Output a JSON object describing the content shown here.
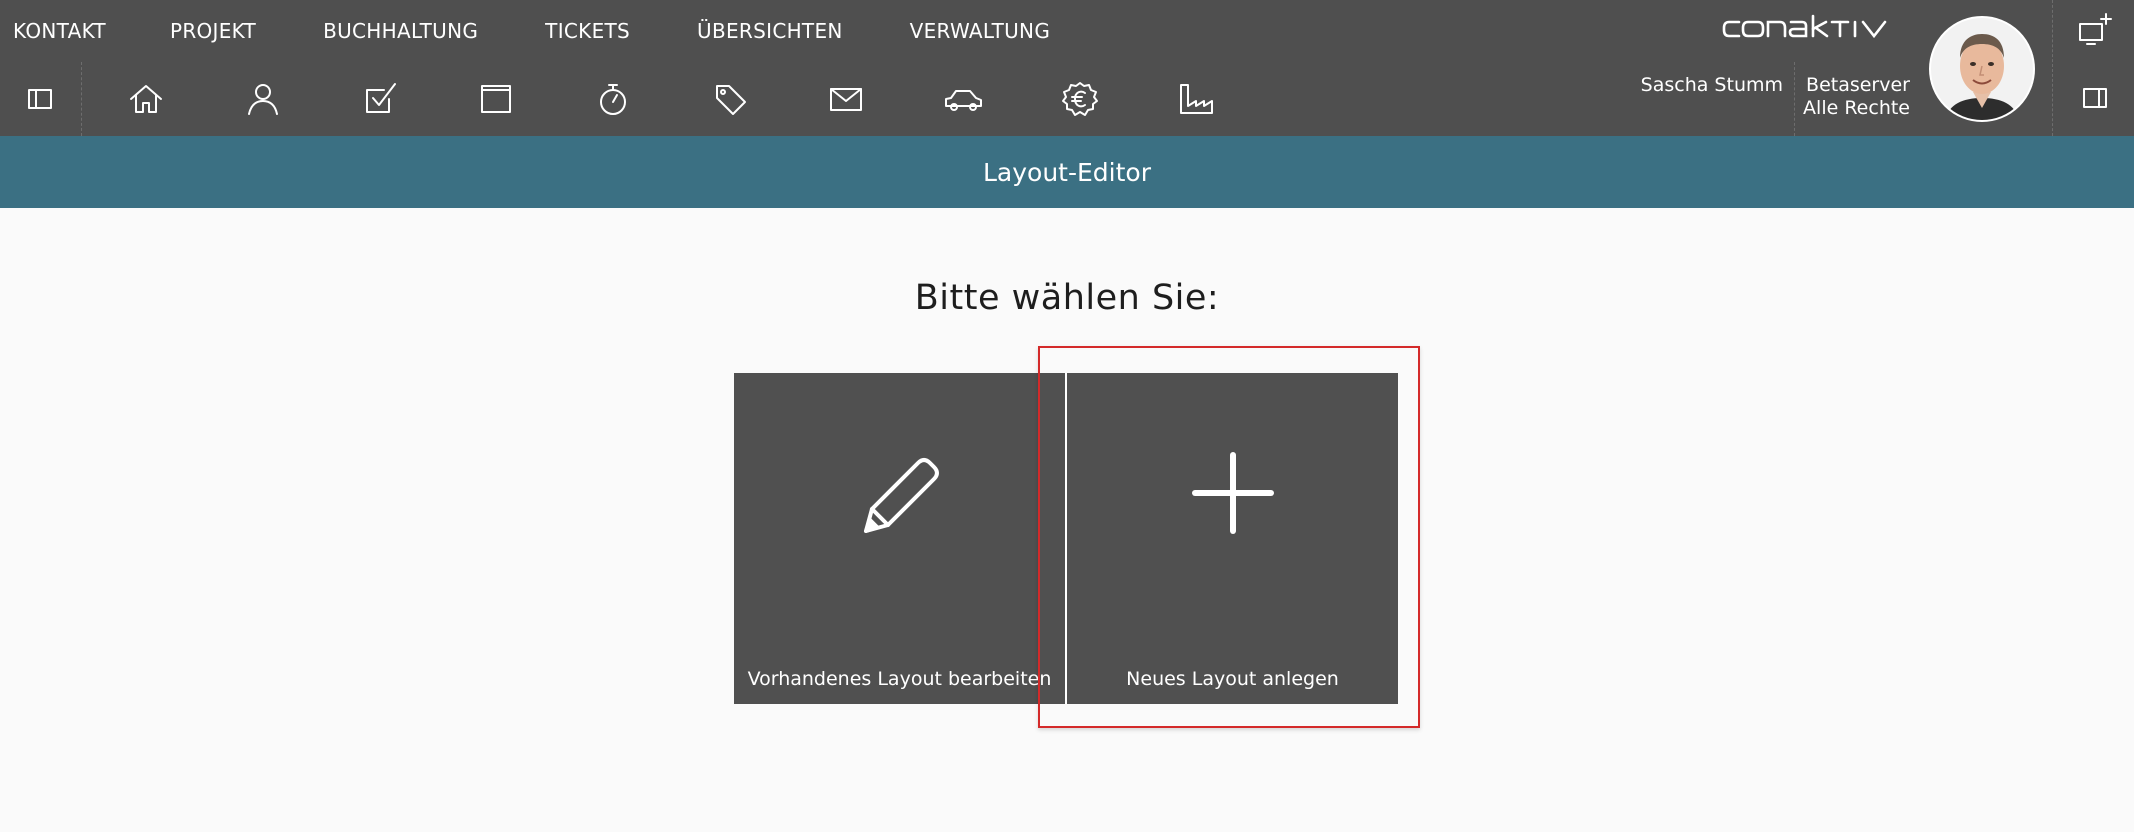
{
  "menu": [
    {
      "label": "KONTAKT"
    },
    {
      "label": "PROJEKT"
    },
    {
      "label": "BUCHHALTUNG"
    },
    {
      "label": "TICKETS"
    },
    {
      "label": "ÜBERSICHTEN"
    },
    {
      "label": "VERWALTUNG"
    }
  ],
  "toolbar_icons": [
    "sidebar-left-icon",
    "home-icon",
    "person-icon",
    "checkbox-icon",
    "window-icon",
    "stopwatch-icon",
    "tag-icon",
    "mail-icon",
    "car-icon",
    "euro-badge-icon",
    "factory-icon"
  ],
  "brand": {
    "logo_text": "conaktiv"
  },
  "user": {
    "name": "Sascha Stumm",
    "server": "Betaserver",
    "rights": "Alle Rechte"
  },
  "right_icons": [
    "new-window-icon",
    "sidebar-right-icon"
  ],
  "header": {
    "title": "Layout-Editor"
  },
  "main": {
    "prompt": "Bitte wählen Sie:",
    "tiles": [
      {
        "label": "Vorhandenes Layout bearbeiten",
        "icon": "pencil-icon"
      },
      {
        "label": "Neues Layout anlegen",
        "icon": "plus-icon"
      }
    ]
  },
  "colors": {
    "topbar": "#4f4f4f",
    "titlebar": "#3b7083",
    "tile": "#505050",
    "highlight": "#d42a2a",
    "background": "#fafafa"
  }
}
